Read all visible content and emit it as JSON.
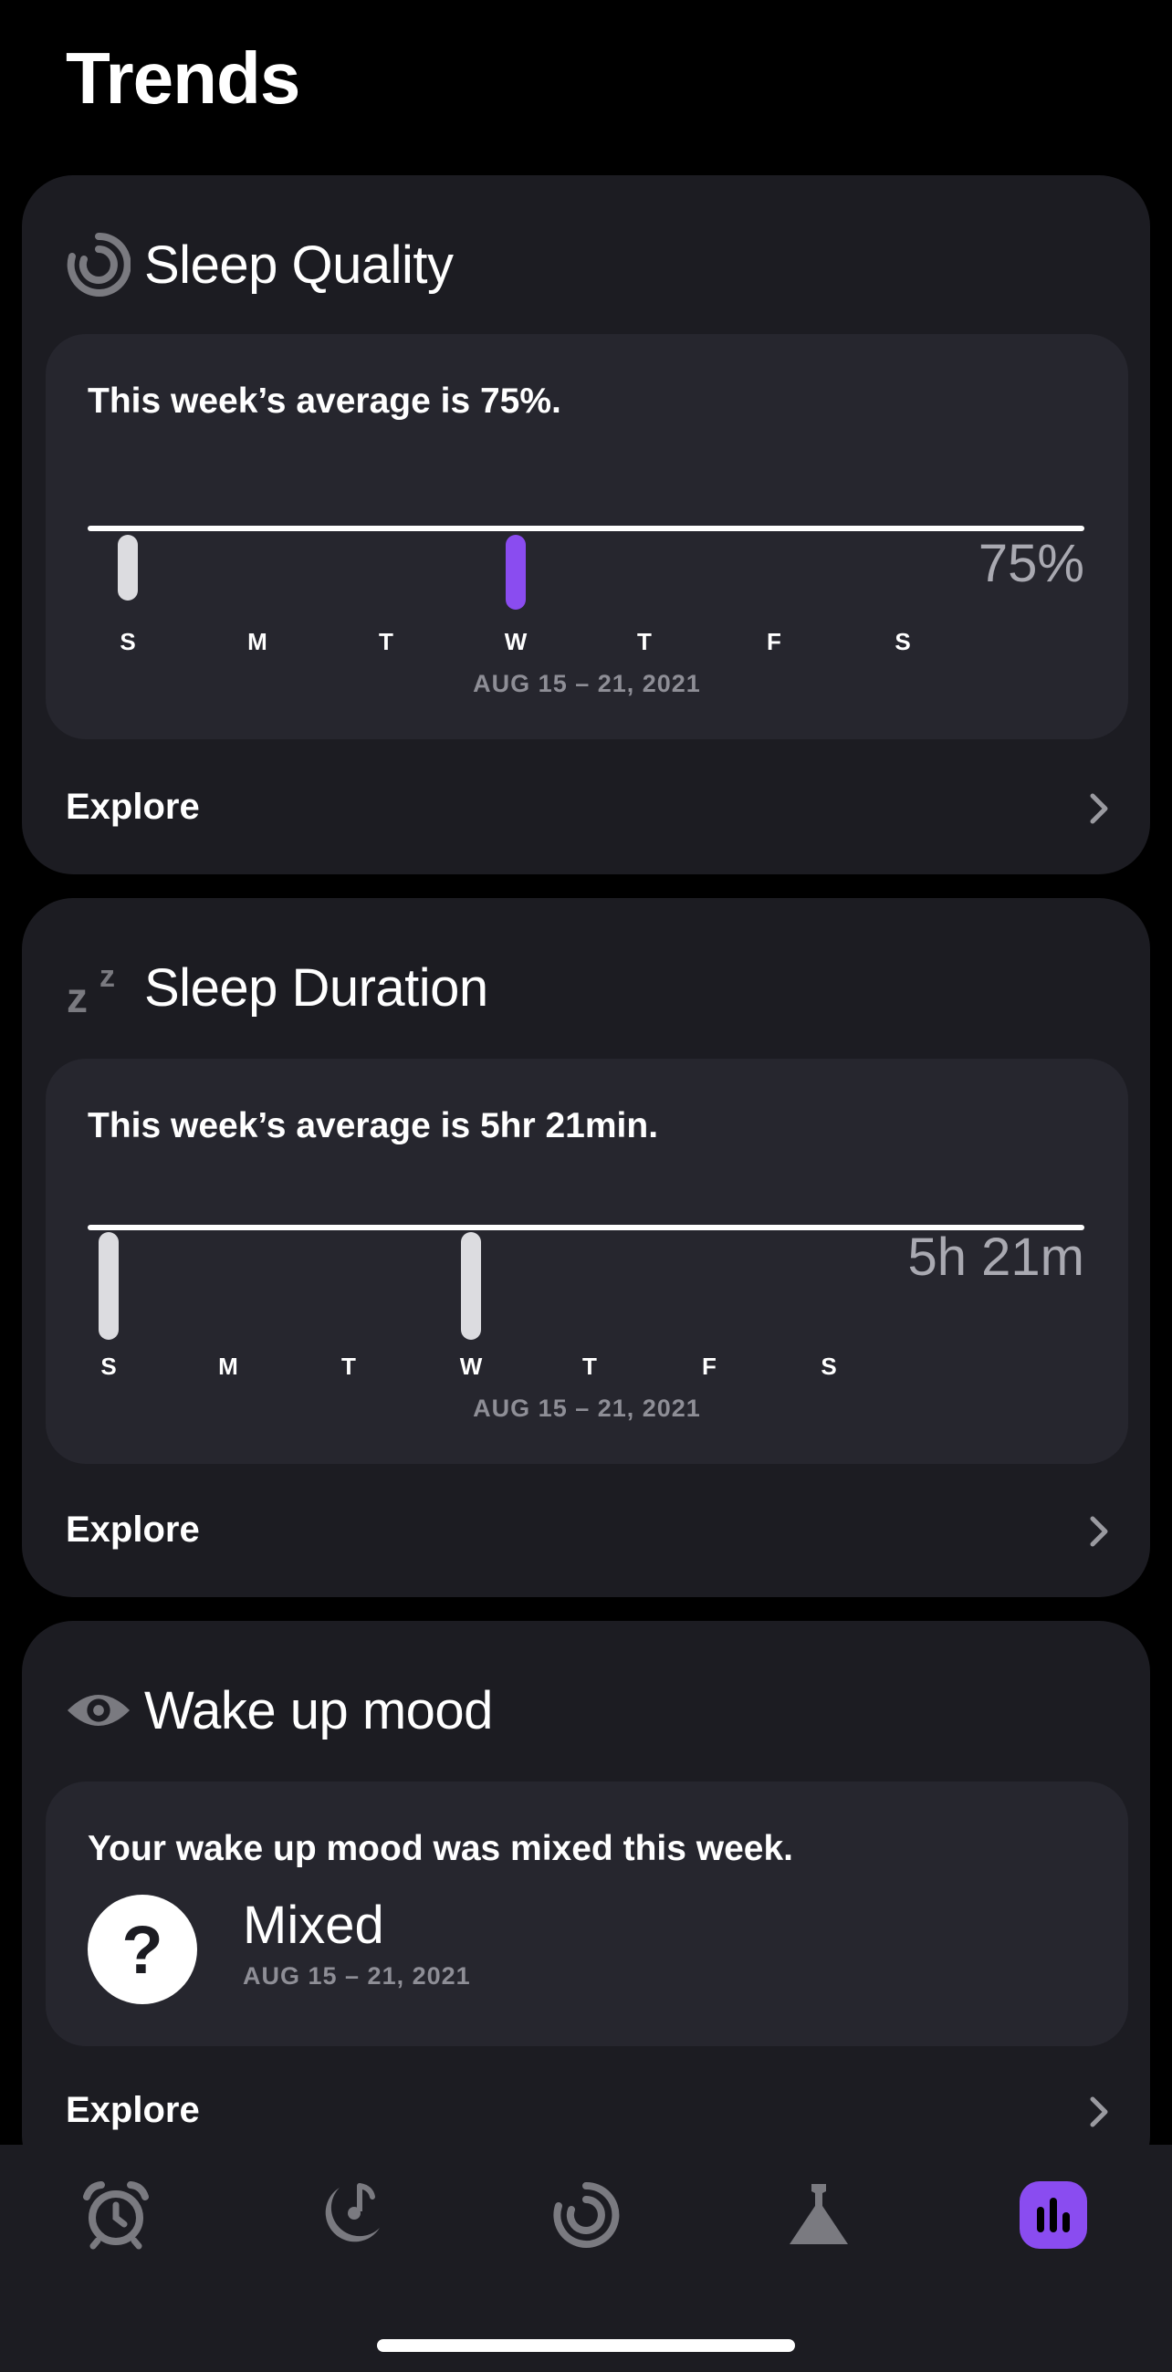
{
  "page": {
    "title": "Trends"
  },
  "sleep_quality": {
    "title": "Sleep Quality",
    "icon": "sleep-quality-ring-icon",
    "summary": "This week’s average is 75%.",
    "value": "75%",
    "days": [
      "S",
      "M",
      "T",
      "W",
      "T",
      "F",
      "S"
    ],
    "range": "AUG 15 – 21, 2021",
    "explore": "Explore",
    "accent": "#8a4cf0"
  },
  "sleep_duration": {
    "title": "Sleep Duration",
    "icon": "zzz-icon",
    "summary": "This week’s average is 5hr 21min.",
    "value": "5h 21m",
    "days": [
      "S",
      "M",
      "T",
      "W",
      "T",
      "F",
      "S"
    ],
    "range": "AUG 15 – 21, 2021",
    "explore": "Explore"
  },
  "wake_mood": {
    "title": "Wake up mood",
    "icon": "eye-icon",
    "summary": "Your wake up mood was mixed this week.",
    "mood_symbol": "?",
    "mood": "Mixed",
    "range": "AUG 15 – 21, 2021",
    "explore": "Explore"
  },
  "tabbar": {
    "tabs": [
      "alarm-clock-icon",
      "moon-music-icon",
      "sleep-ring-icon",
      "flask-icon",
      "bar-chart-icon"
    ],
    "active": "bar-chart-icon"
  }
}
